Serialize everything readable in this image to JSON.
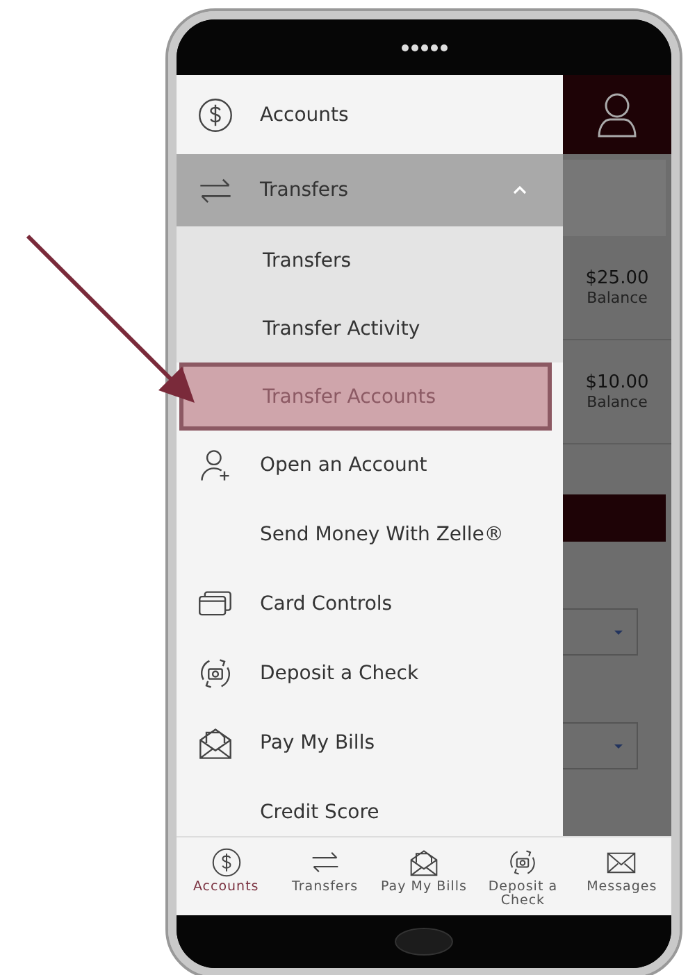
{
  "menu": [
    {
      "label": "Accounts",
      "expanded": false
    },
    {
      "label": "Transfers",
      "expanded": true,
      "children": [
        {
          "label": "Transfers",
          "selected": false
        },
        {
          "label": "Transfer Activity",
          "selected": false
        },
        {
          "label": "Transfer Accounts",
          "selected": true
        }
      ]
    },
    {
      "label": "Open an Account"
    },
    {
      "label": "Send Money With Zelle®"
    },
    {
      "label": "Card Controls"
    },
    {
      "label": "Deposit a Check"
    },
    {
      "label": "Pay My Bills"
    },
    {
      "label": "Credit Score"
    }
  ],
  "background": {
    "balances": [
      {
        "amount": "$25.00",
        "label": "Balance"
      },
      {
        "amount": "$10.00",
        "label": "Balance"
      }
    ]
  },
  "tab_bar": [
    {
      "label": "Accounts",
      "selected": true
    },
    {
      "label": "Transfers",
      "selected": false
    },
    {
      "label": "Pay My Bills",
      "selected": false
    },
    {
      "label": "Deposit a Check",
      "selected": false
    },
    {
      "label": "Messages",
      "selected": false
    }
  ]
}
